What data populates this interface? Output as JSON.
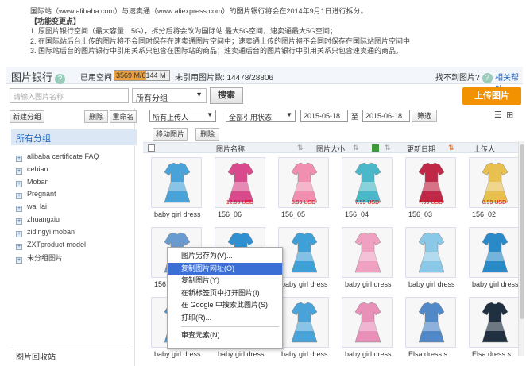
{
  "notice": {
    "line1": "国际站（www.alibaba.com）与速卖通（www.aliexpress.com）的图片银行将会在2014年9月1日进行拆分。",
    "line2": "【功能变更点】",
    "line3": "1. 原图片银行空间（最大容量：5G），拆分后将会改为国际站 最大5G空间，速卖通最大5G空间；",
    "line4": "2. 在国际站后台上传的图片将不会同时保存在速卖通图片空间中；速卖通上传的图片将不会同时保存在国际站图片空间中",
    "line5": "3. 国际站后台的图片银行中引用关系只包含在国际站的商品；速卖通后台的图片银行中引用关系只包含速卖通的商品。"
  },
  "header": {
    "title": "图片银行",
    "used_label": "已用空间",
    "usage_text": "3569 M/6144 M",
    "usage_fraction": 0.581,
    "unreferenced": "未引用图片数: 14478/28806",
    "not_found": "找不到图片?",
    "related_help": "相关帮助"
  },
  "search": {
    "placeholder": "请输入图片名称",
    "group_select": "所有分组",
    "search_button": "搜索",
    "upload_button": "上传图片"
  },
  "sidebar": {
    "new_group": "新建分组",
    "delete": "删除",
    "rename": "重命名",
    "all_groups": "所有分组",
    "items": [
      {
        "label": "alibaba certificate FAQ"
      },
      {
        "label": "cebian"
      },
      {
        "label": "Moban"
      },
      {
        "label": "Pregnant"
      },
      {
        "label": "wai lai"
      },
      {
        "label": "zhuangxiu"
      },
      {
        "label": "zidingyi moban"
      },
      {
        "label": "ZXTproduct model"
      },
      {
        "label": "未分组图片"
      }
    ],
    "recycle": "图片回收站"
  },
  "filters": {
    "uploader": "所有上传人",
    "ref_status": "全部引用状态",
    "date_from": "2015-05-18",
    "to": "至",
    "date_to": "2015-06-18",
    "filter_button": "筛选"
  },
  "actions": {
    "move": "移动图片",
    "delete": "删除"
  },
  "table": {
    "col_name": "图片名称",
    "col_size": "图片大小",
    "col_date": "更新日期",
    "col_uploader": "上传人"
  },
  "images": [
    {
      "caption": "baby girl dress",
      "price": "",
      "color": "#4aa3d8"
    },
    {
      "caption": "156_06",
      "price": "12.99 USD",
      "color": "#d94a8c"
    },
    {
      "caption": "156_05",
      "price": "8.99 USD",
      "color": "#f08fb0"
    },
    {
      "caption": "156_04",
      "price": "7.99 USD",
      "color": "#4ab8c8"
    },
    {
      "caption": "156_03",
      "price": "7.99 USD",
      "color": "#c02848"
    },
    {
      "caption": "156_02",
      "price": "8.99 USD",
      "color": "#e8c050"
    },
    {
      "caption": "156",
      "price": "",
      "color": "#6a9bd0"
    },
    {
      "caption": "",
      "price": "",
      "color": "#2f8fd0"
    },
    {
      "caption": "baby girl dress",
      "price": "",
      "color": "#3fa0d8"
    },
    {
      "caption": "baby girl dress",
      "price": "",
      "color": "#f0a0c0"
    },
    {
      "caption": "baby girl dress",
      "price": "",
      "color": "#8ac8e8"
    },
    {
      "caption": "baby girl dress",
      "price": "",
      "color": "#2a8ac8"
    },
    {
      "caption": "baby girl dress",
      "price": "",
      "color": "#3a9ae0"
    },
    {
      "caption": "baby girl dress",
      "price": "",
      "color": "#ffffff"
    },
    {
      "caption": "baby girl dress",
      "price": "",
      "color": "#4aa3d8"
    },
    {
      "caption": "baby girl dress",
      "price": "",
      "color": "#e890b8"
    },
    {
      "caption": "Elsa dress s",
      "price": "",
      "color": "#5088c8"
    },
    {
      "caption": "Elsa dress s",
      "price": "",
      "color": "#203040"
    }
  ],
  "context_menu": {
    "items": [
      {
        "label": "图片另存为(V)..."
      },
      {
        "label": "复制图片网址(O)"
      },
      {
        "label": "复制图片(Y)"
      },
      {
        "label": "在新标签页中打开图片(I)"
      },
      {
        "label": "在 Google 中搜索此图片(S)"
      },
      {
        "label": "打印(R)..."
      },
      {
        "label": "审查元素(N)"
      }
    ]
  },
  "colors": {
    "accent": "#f39200",
    "link": "#2266bb",
    "highlight": "#3b6fd6",
    "usage_fill": "#e8a040"
  }
}
